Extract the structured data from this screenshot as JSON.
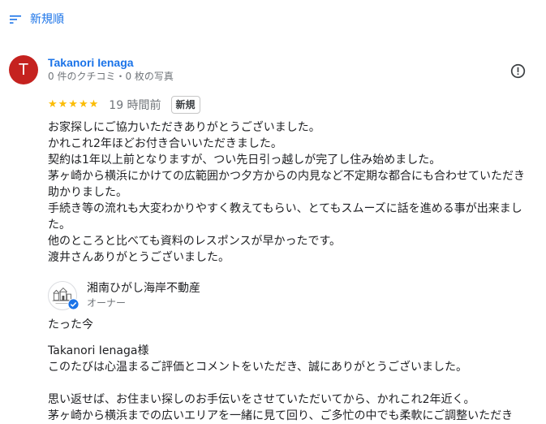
{
  "sort": {
    "icon": "sort-icon",
    "label": "新規順"
  },
  "review": {
    "avatar_letter": "T",
    "avatar_color": "#c5221f",
    "reviewer_name": "Takanori Ienaga",
    "reviewer_meta": "0 件のクチコミ・0 枚の写真",
    "rating": 5,
    "stars": "★★★★★",
    "time": "19 時間前",
    "badge": "新規",
    "lines": [
      "お家探しにご協力いただきありがとうございました。",
      "かれこれ2年ほどお付き合いいただきました。",
      "契約は1年以上前となりますが、つい先日引っ越しが完了し住み始めました。",
      "茅ヶ崎から横浜にかけての広範囲かつ夕方からの内見など不定期な都合にも合わせていただき",
      "助かりました。",
      "手続き等の流れも大変わかりやすく教えてもらい、とてもスムーズに話を進める事が出来まし",
      "た。",
      "他のところと比べても資料のレスポンスが早かったです。",
      "渡井さんありがとうございました。"
    ]
  },
  "owner_reply": {
    "owner_name": "湘南ひがし海岸不動産",
    "owner_role": "オーナー",
    "time": "たった今",
    "greeting": "Takanori Ienaga様",
    "line1": "このたびは心温まるご評価とコメントをいただき、誠にありがとうございました。",
    "line2": "思い返せば、お住まい探しのお手伝いをさせていただいてから、かれこれ2年近く。",
    "line3": "茅ヶ崎から横浜までの広いエリアを一緒に見て回り、ご多忙の中でも柔軟にご調整いただき"
  },
  "colors": {
    "link": "#1a73e8",
    "star": "#fbbc04",
    "muted": "#70757a",
    "verified": "#1a73e8"
  }
}
